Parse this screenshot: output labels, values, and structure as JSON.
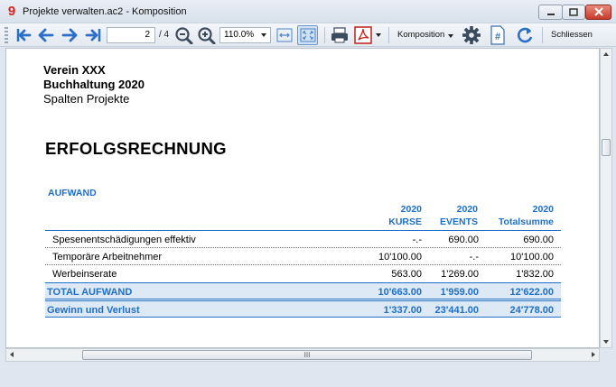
{
  "window": {
    "title": "Projekte verwalten.ac2 - Komposition",
    "app_icon_glyph": "9"
  },
  "toolbar": {
    "page_value": "2",
    "page_total": "/ 4",
    "zoom_value": "110.0%",
    "komposition_label": "Komposition",
    "close_label": "Schliessen"
  },
  "document": {
    "org": "Verein XXX",
    "book": "Buchhaltung 2020",
    "subtitle": "Spalten Projekte",
    "heading": "ERFOLGSRECHNUNG",
    "section": "AUFWAND",
    "columns": [
      {
        "year": "2020",
        "name": "KURSE"
      },
      {
        "year": "2020",
        "name": "EVENTS"
      },
      {
        "year": "2020",
        "name": "Totalsumme"
      }
    ],
    "rows": [
      {
        "label": "Spesenentschädigungen effektiv",
        "kurse": "-.-",
        "events": "690.00",
        "total": "690.00"
      },
      {
        "label": "Temporäre Arbeitnehmer",
        "kurse": "10'100.00",
        "events": "-.-",
        "total": "10'100.00"
      },
      {
        "label": "Werbeinserate",
        "kurse": "563.00",
        "events": "1'269.00",
        "total": "1'832.00"
      }
    ],
    "total_aufwand": {
      "label": "TOTAL AUFWAND",
      "kurse": "10'663.00",
      "events": "1'959.00",
      "total": "12'622.00"
    },
    "gewinn": {
      "label": "Gewinn und Verlust",
      "kurse": "1'337.00",
      "events": "23'441.00",
      "total": "24'778.00"
    }
  },
  "scrollbar": {
    "h_thumb_glyph": "III"
  },
  "colors": {
    "accent_blue": "#1f6fc6",
    "nav_blue": "#2a6fc9",
    "total_bg": "#dde9f5"
  }
}
